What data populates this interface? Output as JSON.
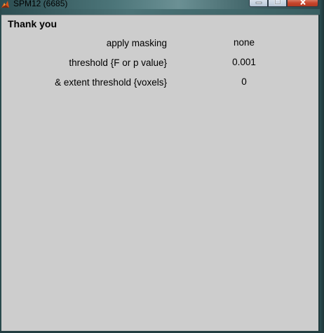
{
  "window": {
    "title": "SPM12 (6685)"
  },
  "content": {
    "heading": "Thank you",
    "rows": [
      {
        "label": "apply masking",
        "value": "none"
      },
      {
        "label": "threshold {F or p value}",
        "value": "0.001"
      },
      {
        "label": "& extent threshold {voxels}",
        "value": "0"
      }
    ]
  },
  "icons": {
    "app": "matlab-icon",
    "minimize": "minimize-icon",
    "maximize": "maximize-icon",
    "close": "close-icon"
  }
}
